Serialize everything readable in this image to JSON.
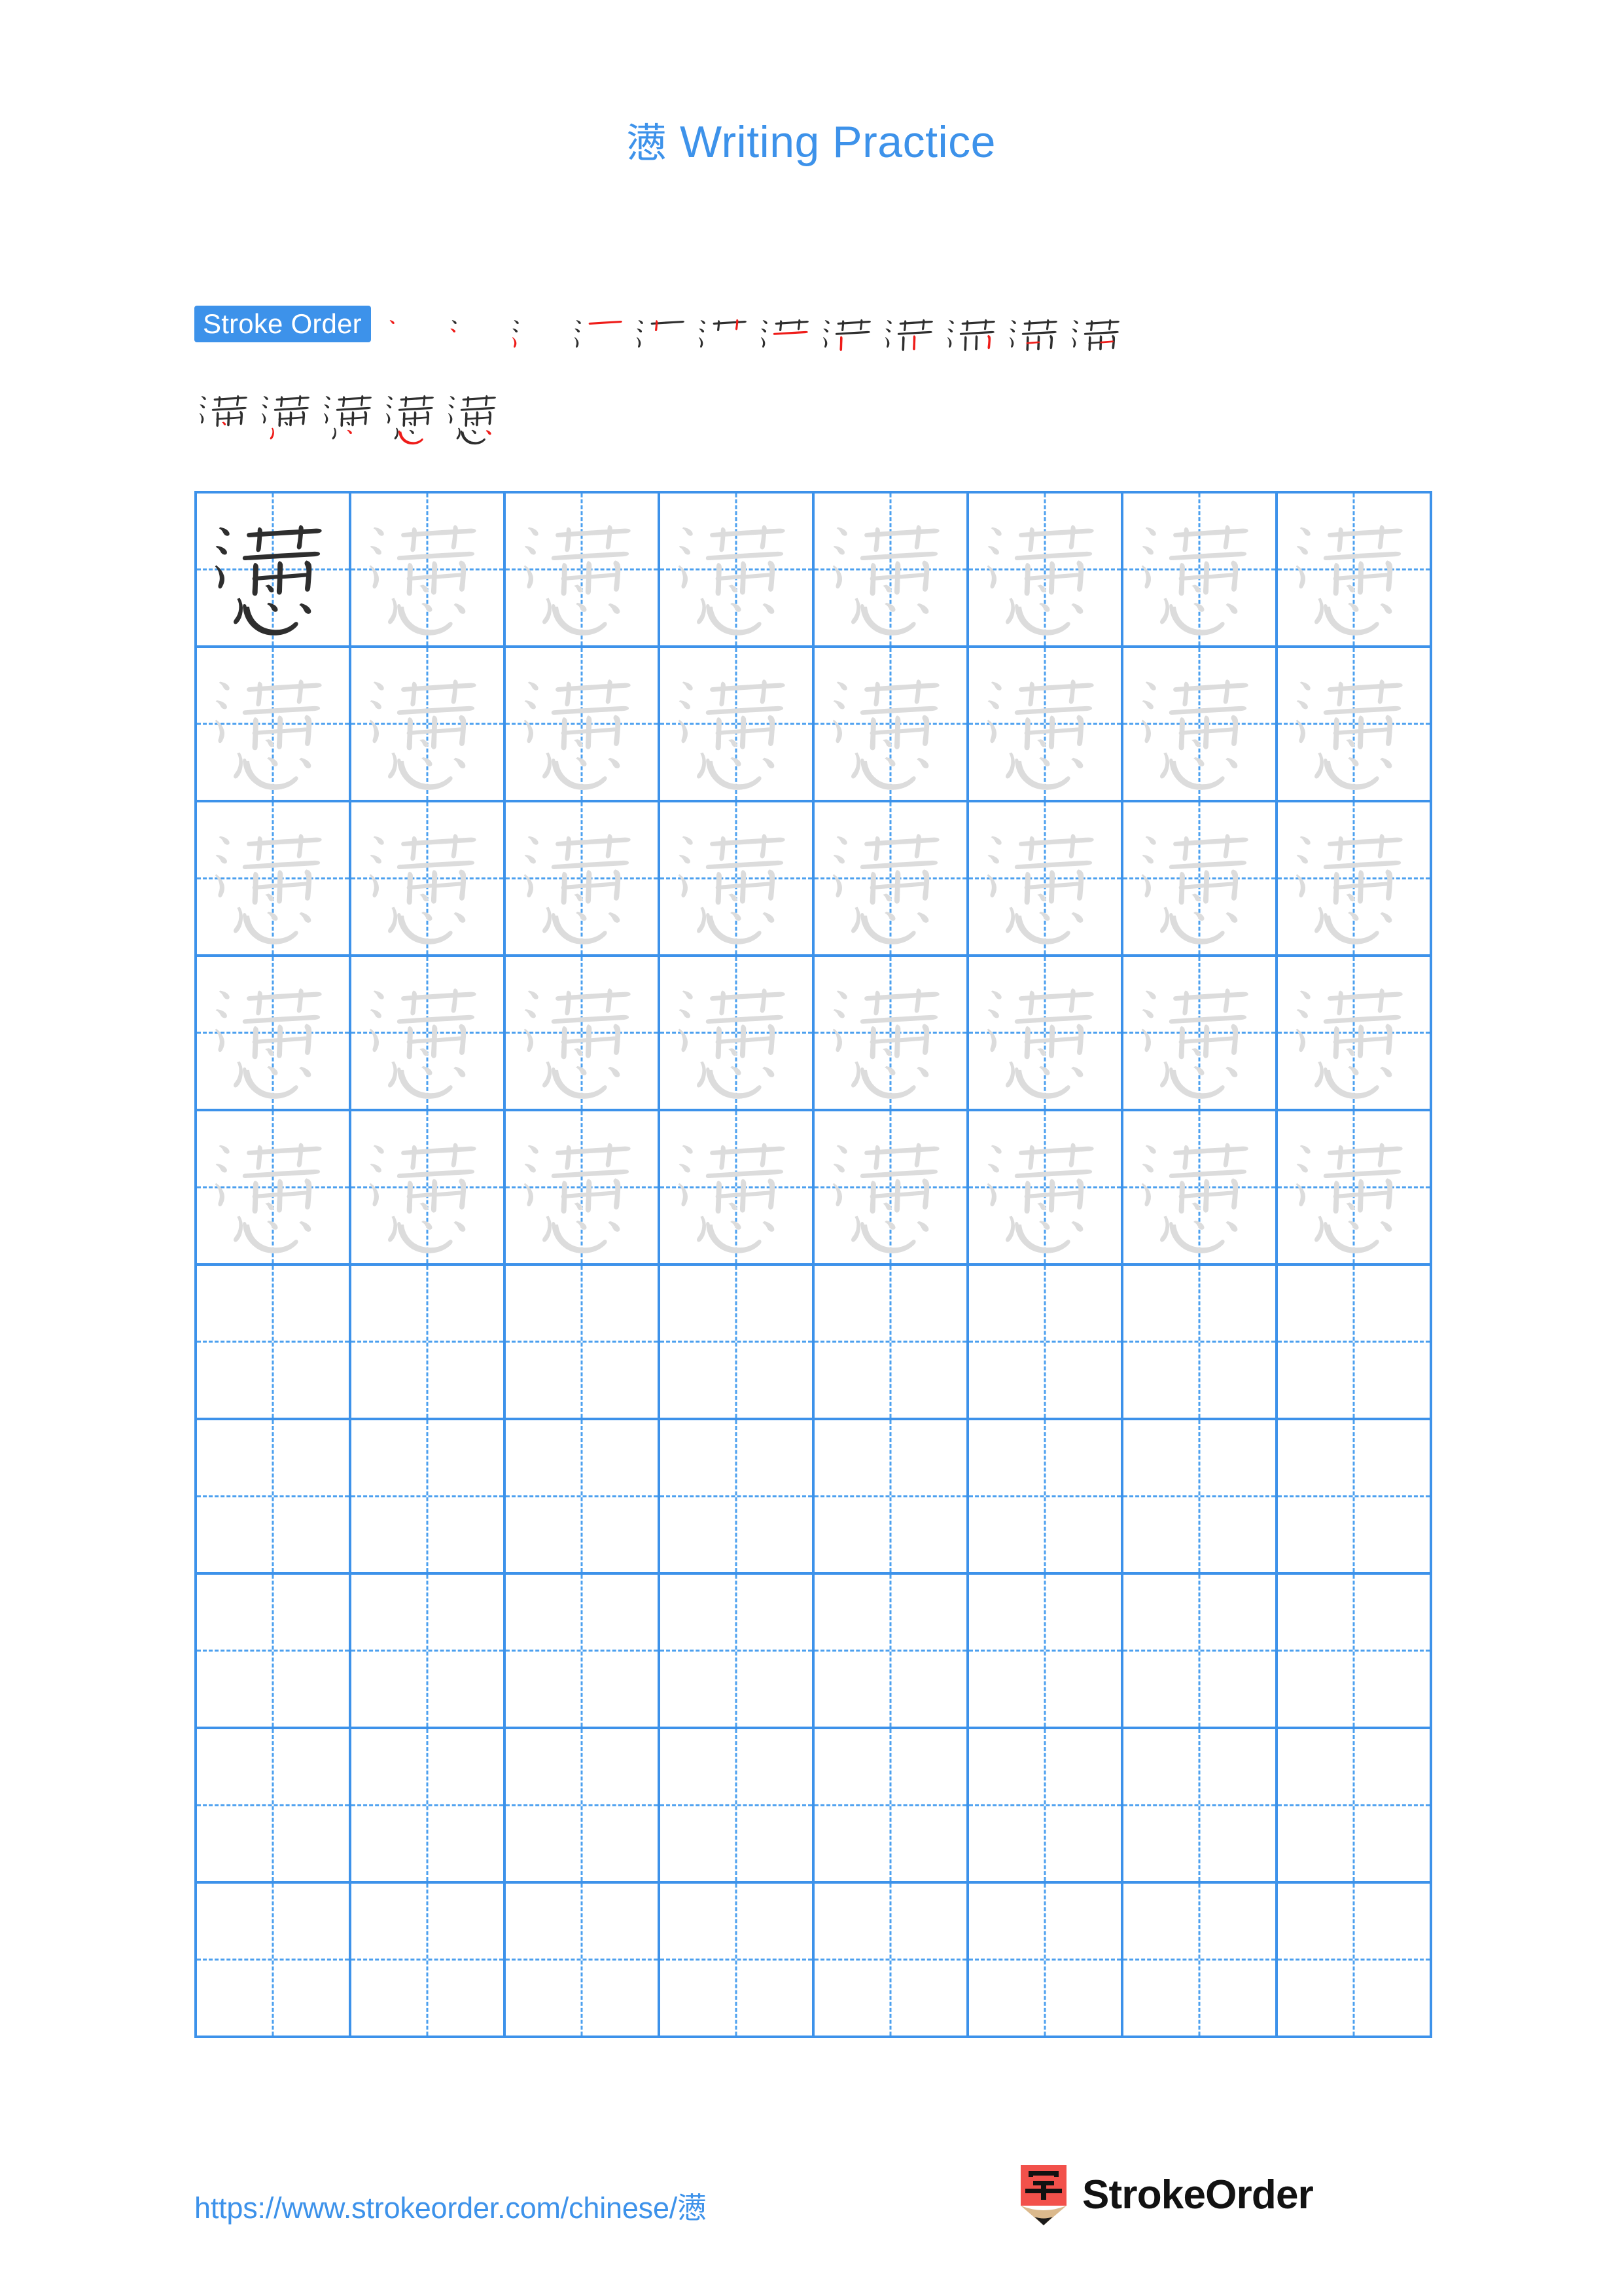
{
  "page": {
    "background_color": "#ffffff",
    "accent_color": "#3d92ea",
    "grid_line_color": "#4ca0ef",
    "model_char_color": "#2e2e2e",
    "trace_char_color": "#dcdcdc",
    "stroke_ink_color": "#2e2e2e",
    "stroke_new_color": "#ee1c19"
  },
  "header": {
    "character": "懑",
    "title_suffix": " Writing Practice",
    "full_title": "懑 Writing Practice"
  },
  "stroke_order": {
    "badge_label": "Stroke Order",
    "total_strokes": 17,
    "steps_row1_count": 12,
    "steps_row2_count": 5,
    "steps": [
      {
        "index": 1,
        "partial": "丶"
      },
      {
        "index": 2,
        "partial": "丶丶"
      },
      {
        "index": 3,
        "partial": "氵"
      },
      {
        "index": 4,
        "partial": "氵一"
      },
      {
        "index": 5,
        "partial": "氵丆"
      },
      {
        "index": 6,
        "partial": "氵艹"
      },
      {
        "index": 7,
        "partial": "氵艹丨"
      },
      {
        "index": 8,
        "partial": "洋"
      },
      {
        "index": 9,
        "partial": "湍"
      },
      {
        "index": 10,
        "partial": "满(10)"
      },
      {
        "index": 11,
        "partial": "满(11)"
      },
      {
        "index": 12,
        "partial": "满(12)"
      },
      {
        "index": 13,
        "partial": "满"
      },
      {
        "index": 14,
        "partial": "满丿"
      },
      {
        "index": 15,
        "partial": "懑(15)"
      },
      {
        "index": 16,
        "partial": "懑(16)"
      },
      {
        "index": 17,
        "partial": "懑"
      }
    ]
  },
  "practice_grid": {
    "rows": 10,
    "columns": 8,
    "cell_size_px": 236,
    "guide_lines": "dashed-crosshair",
    "rows_detail": [
      {
        "row": 1,
        "cells": [
          "model",
          "trace",
          "trace",
          "trace",
          "trace",
          "trace",
          "trace",
          "trace"
        ]
      },
      {
        "row": 2,
        "cells": [
          "trace",
          "trace",
          "trace",
          "trace",
          "trace",
          "trace",
          "trace",
          "trace"
        ]
      },
      {
        "row": 3,
        "cells": [
          "trace",
          "trace",
          "trace",
          "trace",
          "trace",
          "trace",
          "trace",
          "trace"
        ]
      },
      {
        "row": 4,
        "cells": [
          "trace",
          "trace",
          "trace",
          "trace",
          "trace",
          "trace",
          "trace",
          "trace"
        ]
      },
      {
        "row": 5,
        "cells": [
          "trace",
          "trace",
          "trace",
          "trace",
          "trace",
          "trace",
          "trace",
          "trace"
        ]
      },
      {
        "row": 6,
        "cells": [
          "empty",
          "empty",
          "empty",
          "empty",
          "empty",
          "empty",
          "empty",
          "empty"
        ]
      },
      {
        "row": 7,
        "cells": [
          "empty",
          "empty",
          "empty",
          "empty",
          "empty",
          "empty",
          "empty",
          "empty"
        ]
      },
      {
        "row": 8,
        "cells": [
          "empty",
          "empty",
          "empty",
          "empty",
          "empty",
          "empty",
          "empty",
          "empty"
        ]
      },
      {
        "row": 9,
        "cells": [
          "empty",
          "empty",
          "empty",
          "empty",
          "empty",
          "empty",
          "empty",
          "empty"
        ]
      },
      {
        "row": 10,
        "cells": [
          "empty",
          "empty",
          "empty",
          "empty",
          "empty",
          "empty",
          "empty",
          "empty"
        ]
      }
    ]
  },
  "footer": {
    "url_prefix": "https://www.strokeorder.com/chinese/",
    "url_character": "懑",
    "url_full": "https://www.strokeorder.com/chinese/懑",
    "brand_name": "StrokeOrder",
    "logo_character": "字",
    "logo_body_color": "#f2514b",
    "logo_wood_color": "#dbb98c",
    "logo_tip_color": "#1a1a1a"
  }
}
